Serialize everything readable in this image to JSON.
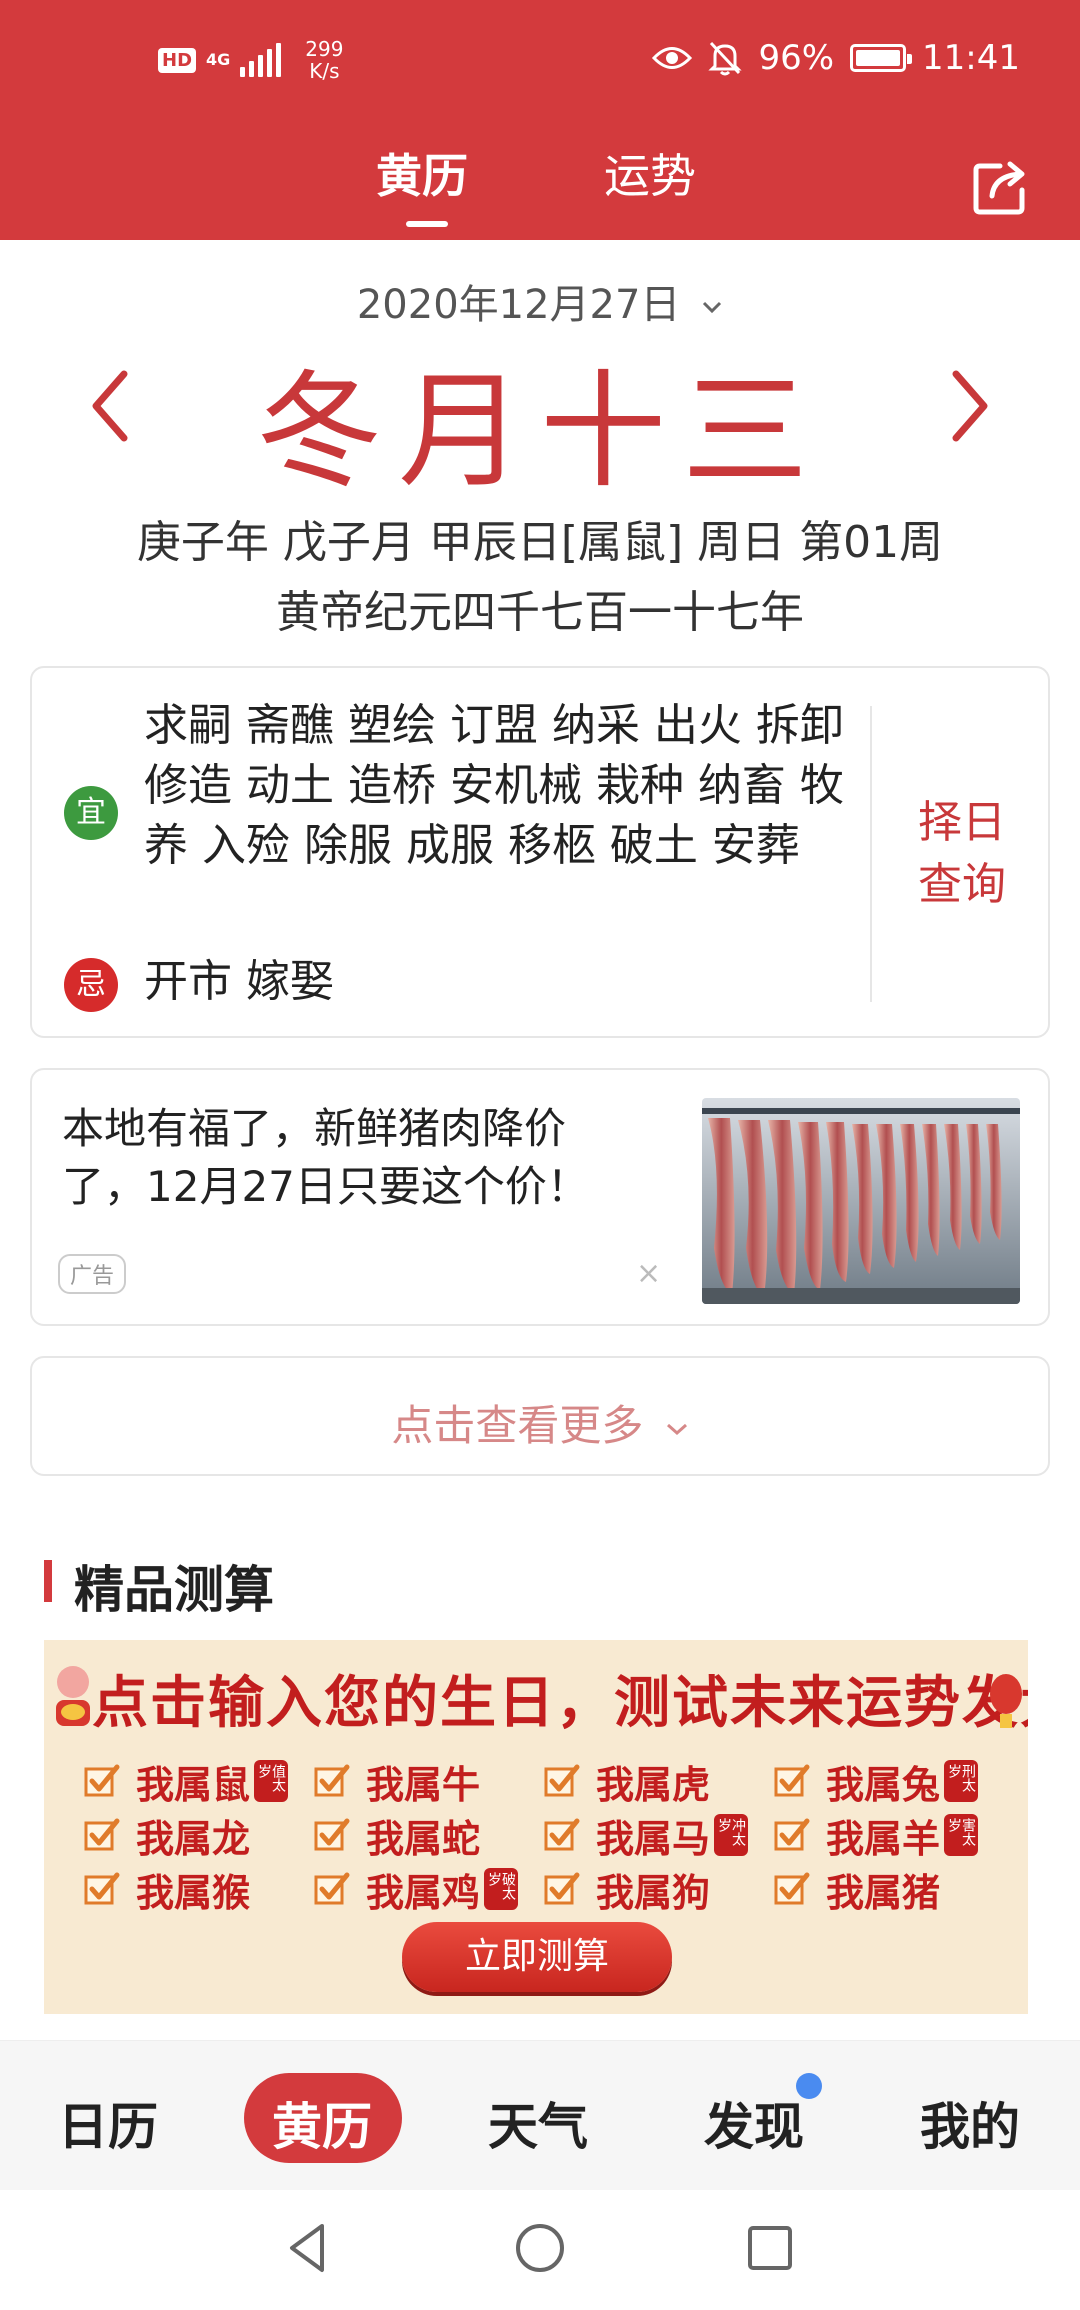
{
  "status_bar": {
    "hd": "HD",
    "network": "4G",
    "speed_value": "299",
    "speed_unit": "K/s",
    "battery": "96%",
    "time": "11:41"
  },
  "tabs": [
    "黄历",
    "运势"
  ],
  "date": {
    "selected": "2020年12月27日",
    "lunar": "冬月十三",
    "ganzhi": "庚子年 戊子月 甲辰日[属鼠] 周日 第01周",
    "huangdi": "黄帝纪元四千七百一十七年"
  },
  "yiji": {
    "yi_label": "宜",
    "yi_items": "求嗣 斋醮 塑绘 订盟 纳采 出火 拆卸 修造 动土 造桥 安机械 栽种 纳畜 牧养 入殓 除服 成服 移柩 破土 安葬",
    "ji_label": "忌",
    "ji_items": "开市 嫁娶",
    "zeri_line1": "择日",
    "zeri_line2": "查询"
  },
  "ad": {
    "title": "本地有福了，新鲜猪肉降价了，12月27日只要这个价！",
    "label": "广告",
    "close": "×"
  },
  "more": {
    "label": "点击查看更多"
  },
  "premium": {
    "section_title": "精品测算",
    "banner_title": "点击输入您的生日，测试未来运势发大财",
    "zodiac": [
      {
        "label": "我属鼠",
        "tag": "值太岁"
      },
      {
        "label": "我属牛",
        "tag": ""
      },
      {
        "label": "我属虎",
        "tag": ""
      },
      {
        "label": "我属兔",
        "tag": "刑太岁"
      },
      {
        "label": "我属龙",
        "tag": ""
      },
      {
        "label": "我属蛇",
        "tag": ""
      },
      {
        "label": "我属马",
        "tag": "冲太岁"
      },
      {
        "label": "我属羊",
        "tag": "害太岁"
      },
      {
        "label": "我属猴",
        "tag": ""
      },
      {
        "label": "我属鸡",
        "tag": "破太岁"
      },
      {
        "label": "我属狗",
        "tag": ""
      },
      {
        "label": "我属猪",
        "tag": ""
      }
    ],
    "cta": "立即测算"
  },
  "bottom_nav": [
    "日历",
    "黄历",
    "天气",
    "发现",
    "我的"
  ],
  "colors": {
    "brand_red": "#d33a3d",
    "yi_green": "#3d9a3f",
    "ji_red": "#d62b2b",
    "dot_blue": "#4a8bf0"
  }
}
